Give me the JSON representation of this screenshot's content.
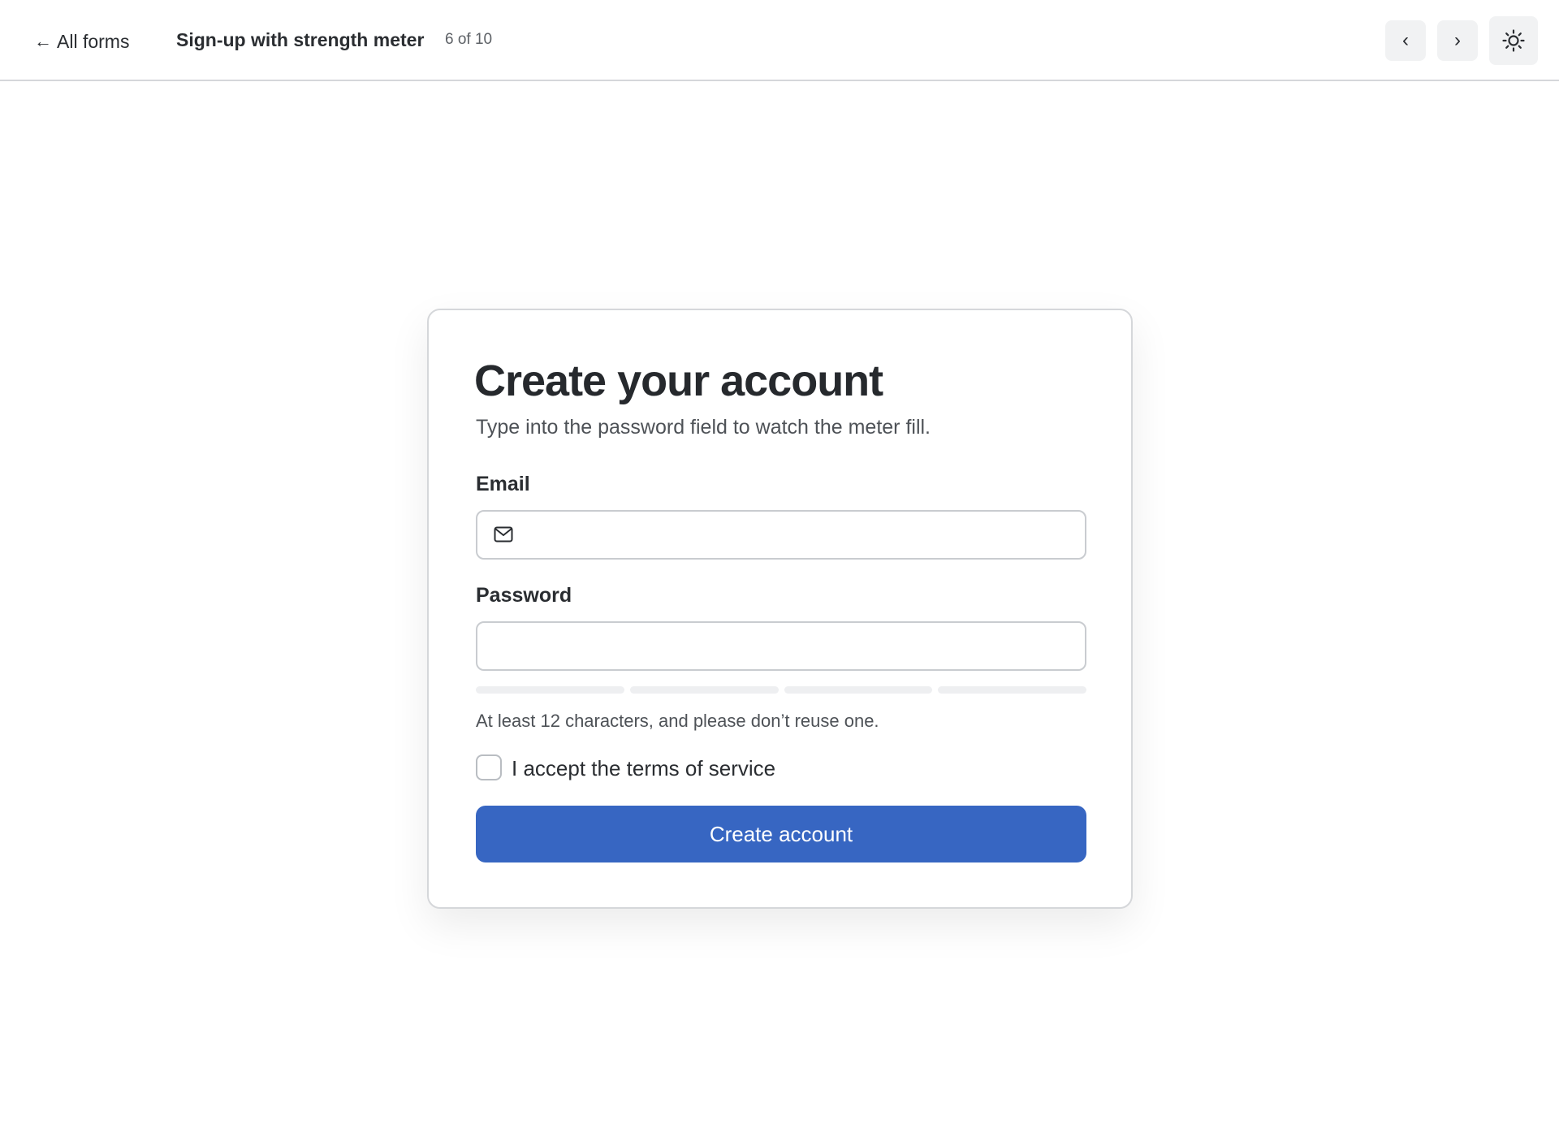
{
  "header": {
    "back_label": "All forms",
    "title": "Sign-up with strength meter",
    "counter": "6 of 10",
    "prev_label": "‹",
    "next_label": "›",
    "theme_icon": "sun-icon"
  },
  "form": {
    "title": "Create your account",
    "subtitle": "Type into the password field to watch the meter fill.",
    "email": {
      "label": "Email",
      "value": "",
      "placeholder": "",
      "icon": "mail-icon"
    },
    "password": {
      "label": "Password",
      "value": "",
      "placeholder": ""
    },
    "strength_meter": {
      "segments": 4,
      "filled": 0,
      "empty_color": "#eeeff1"
    },
    "hint": "At least 12 characters, and please don’t reuse one.",
    "terms": {
      "label": "I accept the terms of service",
      "checked": false
    },
    "submit_label": "Create account"
  },
  "colors": {
    "primary": "#3766c2",
    "border": "#d5d7da",
    "button_bg": "#f1f2f3"
  }
}
